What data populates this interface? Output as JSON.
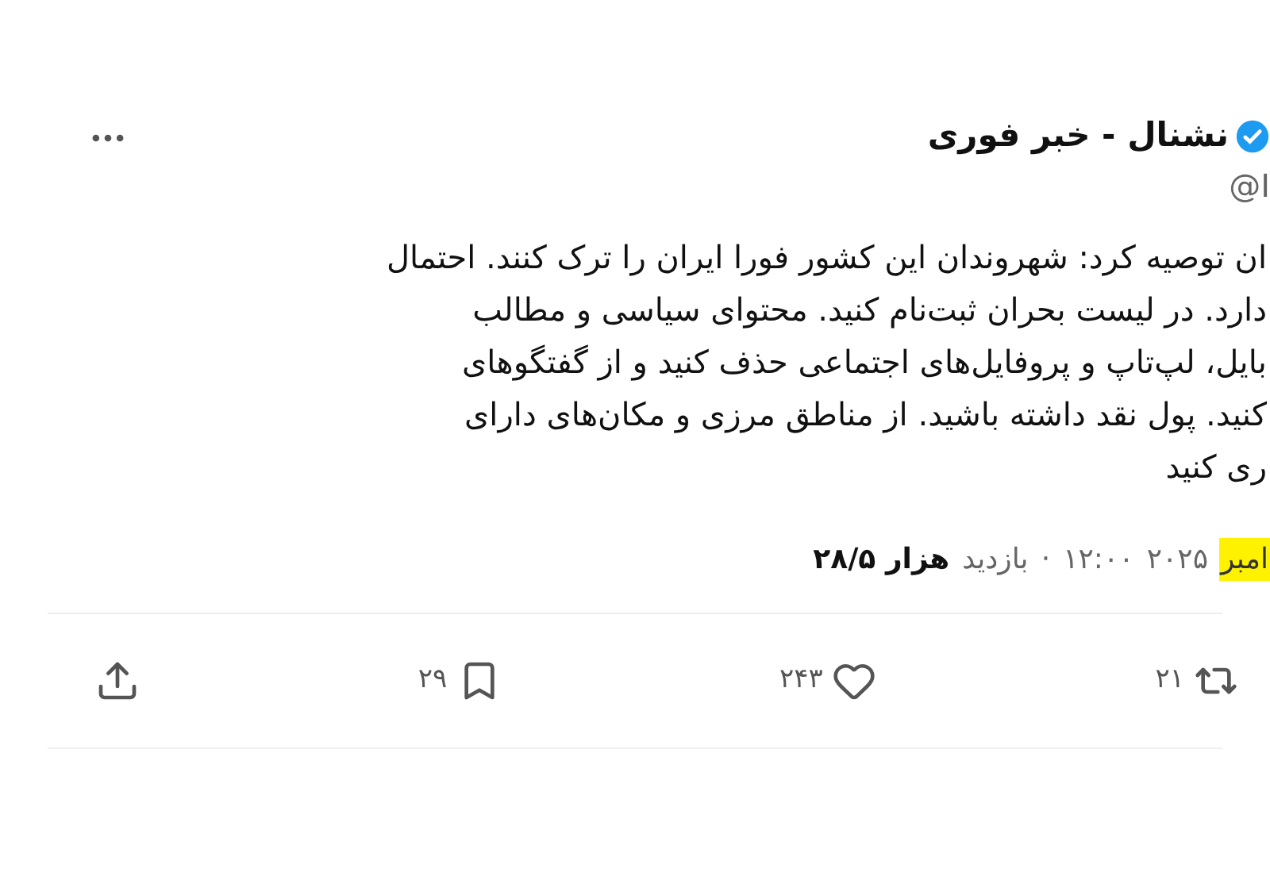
{
  "author": {
    "name": "نشنال - خبر فوری",
    "verified": true,
    "handle": "@I"
  },
  "body_lines": [
    "ان توصیه کرد: شهروندان این کشور فورا ایران را ترک کنند. احتمال",
    "دارد. در لیست بحران ثبت‌نام کنید. محتوای سیاسی و مطالب",
    "بایل، لپ‌تاپ و پروفایل‌های اجتماعی حذف کنید و از گفتگوهای",
    "کنید. پول نقد داشته باشید. از مناطق مرزی و مکان‌های دارای",
    "ری کنید"
  ],
  "meta": [
    {
      "kind": "highlight",
      "text": "امبر"
    },
    {
      "kind": "plain",
      "text": "۲۰۲۵"
    },
    {
      "kind": "plain",
      "text": "۱۲:۰۰"
    },
    {
      "kind": "plain",
      "text": "·"
    },
    {
      "kind": "plain",
      "text": "بازدید"
    },
    {
      "kind": "bold",
      "text": "هزار ۲۸/۵"
    }
  ],
  "actions": [
    {
      "kind": "retweet",
      "count": "۲۱"
    },
    {
      "kind": "like",
      "count": "۲۴۳"
    },
    {
      "kind": "bookmark",
      "count": "۲۹"
    },
    {
      "kind": "share"
    }
  ]
}
